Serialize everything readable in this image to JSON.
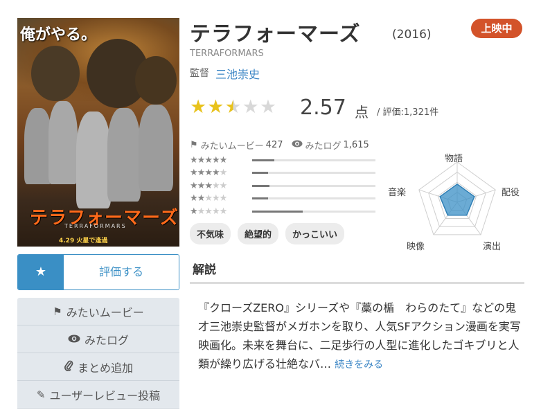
{
  "poster": {
    "tagline": "俺がやる。",
    "title_ja": "テラフォーマーズ",
    "title_en": "TERRAFORMARS",
    "release": "4.29 火星で逢過"
  },
  "movie": {
    "title": "テラフォーマーズ",
    "year": "(2016)",
    "status": "上映中",
    "original_title": "TERRAFORMARS",
    "director_label": "監督",
    "director_name": "三池崇史"
  },
  "rating": {
    "stars_value": 2.5,
    "score": "2.57",
    "unit": "点",
    "eval_count": "/ 評価:1,321件"
  },
  "counts": {
    "want_label": "みたいムービー",
    "want_count": "427",
    "seen_label": "みたログ",
    "seen_count": "1,615"
  },
  "distribution": [
    {
      "stars": 5,
      "fraction": 0.18
    },
    {
      "stars": 4,
      "fraction": 0.13
    },
    {
      "stars": 3,
      "fraction": 0.14
    },
    {
      "stars": 2,
      "fraction": 0.13
    },
    {
      "stars": 1,
      "fraction": 0.41
    }
  ],
  "tags": [
    "不気味",
    "絶望的",
    "かっこいい"
  ],
  "radar": {
    "axes": [
      "物語",
      "配役",
      "演出",
      "映像",
      "音楽"
    ],
    "values": [
      0.45,
      0.45,
      0.4,
      0.4,
      0.45
    ]
  },
  "actions": {
    "rate_label": "評価する",
    "want": "みたいムービー",
    "seen": "みたログ",
    "collection": "まとめ追加",
    "review": "ユーザーレビュー投稿"
  },
  "description": {
    "heading": "解説",
    "text": "『クローズZERO』シリーズや『藁の楯　わらのたて』などの鬼才三池崇史監督がメガホンを取り、人気SFアクション漫画を実写映画化。未来を舞台に、二足歩行の人型に進化したゴキブリと人類が繰り広げる壮絶なバ…",
    "more": "続きをみる"
  },
  "colors": {
    "accent": "#3a8fc5",
    "status": "#d3532a",
    "star": "#e8c21c"
  }
}
